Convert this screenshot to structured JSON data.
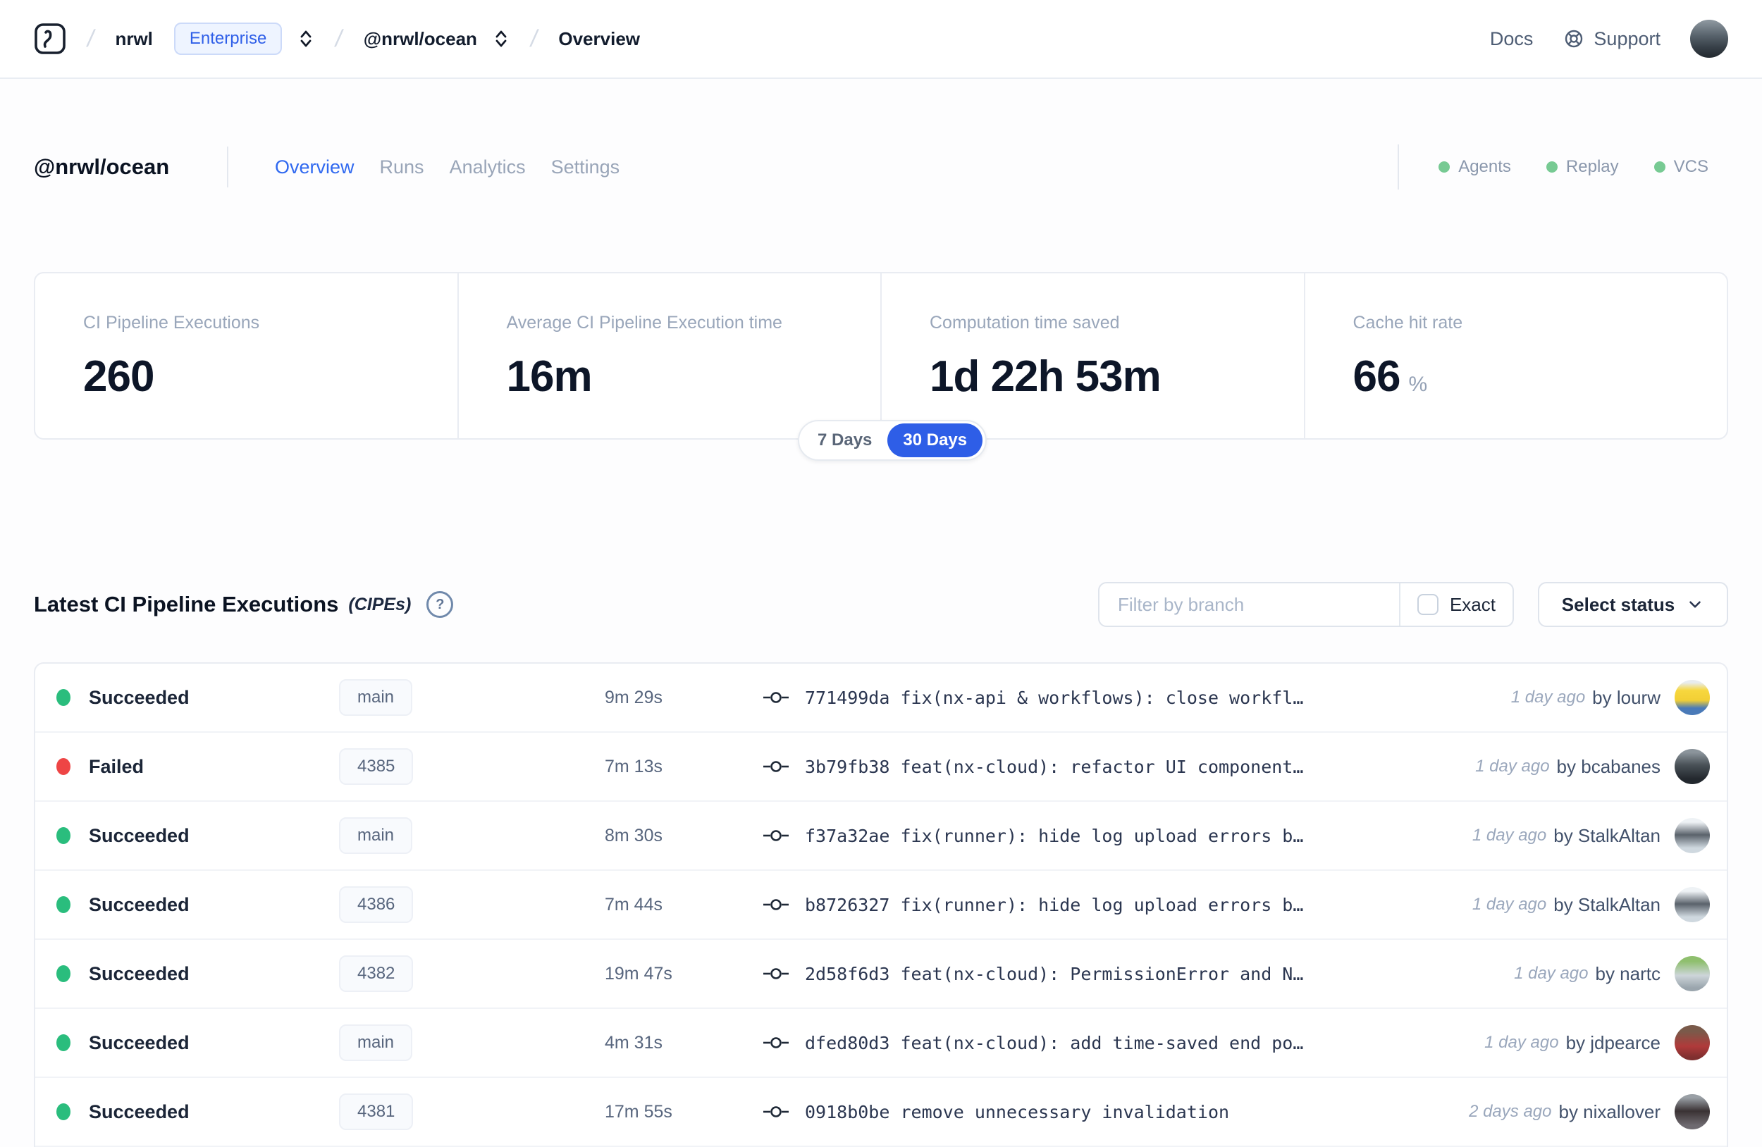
{
  "nav": {
    "org": "nrwl",
    "org_badge": "Enterprise",
    "workspace": "@nrwl/ocean",
    "page": "Overview",
    "docs": "Docs",
    "support": "Support",
    "avatar": [
      "#8a949c 5%",
      "#5a656e 40%",
      "#39424a 70%",
      "#23292f 100%"
    ]
  },
  "header": {
    "title": "@nrwl/ocean",
    "tabs": [
      {
        "label": "Overview",
        "active": true
      },
      {
        "label": "Runs"
      },
      {
        "label": "Analytics"
      },
      {
        "label": "Settings"
      }
    ],
    "services": [
      {
        "label": "Agents",
        "dot": "#77ca93"
      },
      {
        "label": "Replay",
        "dot": "#77ca93"
      },
      {
        "label": "VCS",
        "dot": "#77ca93"
      }
    ]
  },
  "stats": {
    "cards": [
      {
        "label": "CI Pipeline Executions",
        "value": "260"
      },
      {
        "label": "Average CI Pipeline Execution time",
        "value": "16m"
      },
      {
        "label": "Computation time saved",
        "value": "1d 22h 53m"
      },
      {
        "label": "Cache hit rate",
        "value": "66",
        "suffix": "%"
      }
    ],
    "range": {
      "options": [
        "7 Days",
        "30 Days"
      ],
      "selected": "30 Days"
    }
  },
  "section": {
    "title": "Latest CI Pipeline Executions",
    "subtitle": "(CIPEs)",
    "help": "?"
  },
  "filters": {
    "branch_placeholder": "Filter by branch",
    "exact": "Exact",
    "status": "Select status"
  },
  "table": {
    "rows": [
      {
        "status": "Succeeded",
        "dot": "#2abd7d",
        "branch": "main",
        "duration": "9m 29s",
        "commit": "771499da fix(nx-api & workflows): close workfl…",
        "time": "1 day ago",
        "author": "by lourw",
        "avatar": [
          "#e8ecef 8%",
          "#f7d73e 30%",
          "#f2cf35 58%",
          "#4a7ab8 80%"
        ]
      },
      {
        "status": "Failed",
        "dot": "#ee4545",
        "branch": "4385",
        "duration": "7m 13s",
        "commit": "3b79fb38 feat(nx-cloud): refactor UI component…",
        "time": "1 day ago",
        "author": "by bcabanes",
        "avatar": [
          "#8b949b 10%",
          "#4a5258 45%",
          "#23282e 85%"
        ]
      },
      {
        "status": "Succeeded",
        "dot": "#2abd7d",
        "branch": "main",
        "duration": "8m 30s",
        "commit": "f37a32ae fix(runner): hide log upload errors b…",
        "time": "1 day ago",
        "author": "by StalkAltan",
        "avatar": [
          "#eef2f5 12%",
          "#5a626b 48%",
          "#cfd8df 85%"
        ]
      },
      {
        "status": "Succeeded",
        "dot": "#2abd7d",
        "branch": "4386",
        "duration": "7m 44s",
        "commit": "b8726327 fix(runner): hide log upload errors b…",
        "time": "1 day ago",
        "author": "by StalkAltan",
        "avatar": [
          "#eef2f5 12%",
          "#5a626b 48%",
          "#cfd8df 85%"
        ]
      },
      {
        "status": "Succeeded",
        "dot": "#2abd7d",
        "branch": "4382",
        "duration": "19m 47s",
        "commit": "2d58f6d3 feat(nx-cloud): PermissionError and N…",
        "time": "1 day ago",
        "author": "by nartc",
        "avatar": [
          "#8fbf6e 15%",
          "#cdd5d9 55%",
          "#9aa5ad 90%"
        ]
      },
      {
        "status": "Succeeded",
        "dot": "#2abd7d",
        "branch": "main",
        "duration": "4m 31s",
        "commit": "dfed80d3 feat(nx-cloud): add time-saved end po…",
        "time": "1 day ago",
        "author": "by jdpearce",
        "avatar": [
          "#7a5a4a 18%",
          "#b03a3a 60%",
          "#7e2f2f 92%"
        ]
      },
      {
        "status": "Succeeded",
        "dot": "#2abd7d",
        "branch": "4381",
        "duration": "17m 55s",
        "commit": "0918b0be remove unnecessary invalidation",
        "time": "2 days ago",
        "author": "by nixallover",
        "avatar": [
          "#9aa0a6 10%",
          "#3a3234 48%",
          "#6e6a70 88%"
        ]
      }
    ]
  }
}
